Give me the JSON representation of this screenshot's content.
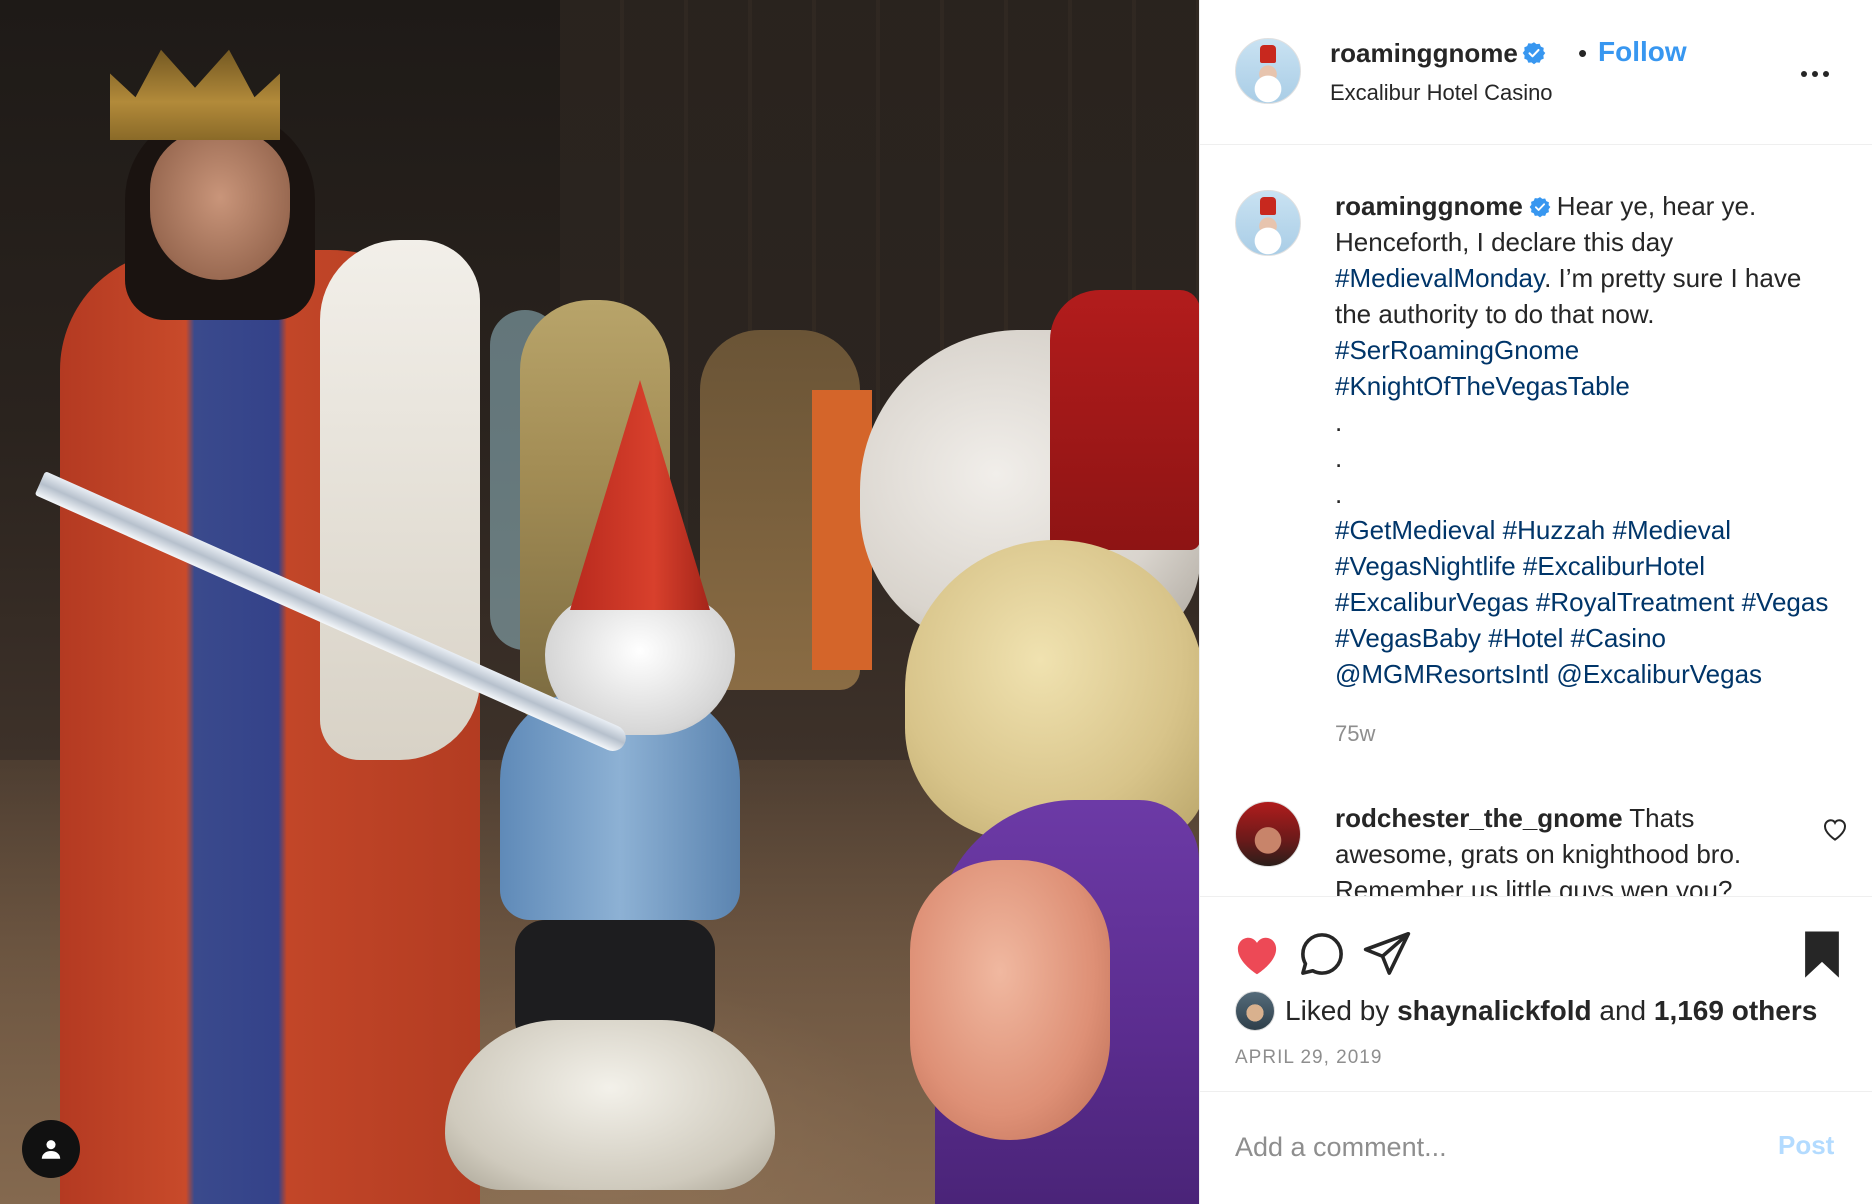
{
  "post": {
    "username": "roaminggnome",
    "verified": true,
    "separator": "•",
    "follow_label": "Follow",
    "location": "Excalibur Hotel Casino",
    "caption": {
      "username": "roaminggnome",
      "text": "Hear ye, hear ye. Henceforth, I declare this day",
      "hashtag_inline": "#MedievalMonday",
      "text2": ". I’m pretty sure I have the authority to do that now.",
      "hashtags_line1": "#SerRoamingGnome",
      "hashtags_line2": "#KnightOfTheVegasTable",
      "dot1": ".",
      "dot2": ".",
      "dot3": ".",
      "hashtags_block": "#GetMedieval #Huzzah #Medieval #VegasNightlife #ExcaliburHotel #ExcaliburVegas #RoyalTreatment #Vegas #VegasBaby #Hotel #Casino @MGMResortsIntl @ExcaliburVegas"
    },
    "time_ago": "75w"
  },
  "comments": [
    {
      "username": "rodchester_the_gnome",
      "text": "Thats awesome, grats on knighthood bro. Remember us little guys wen you?"
    }
  ],
  "actions": {
    "liked": true,
    "saved": true,
    "liked_by_prefix": "Liked by",
    "liked_by_user": "shaynalickfold",
    "liked_by_and": "and",
    "liked_by_others": "1,169 others",
    "date": "APRIL 29, 2019"
  },
  "add_comment": {
    "placeholder": "Add a comment...",
    "post_label": "Post"
  },
  "colors": {
    "link_blue": "#3897f0",
    "hashtag": "#003569",
    "heart_red": "#ed4956",
    "muted": "#8e8e8e"
  },
  "icons": [
    "user-icon",
    "verified-badge-icon",
    "more-options-icon",
    "heart-icon",
    "comment-icon",
    "share-icon",
    "bookmark-icon",
    "comment-heart-icon"
  ]
}
